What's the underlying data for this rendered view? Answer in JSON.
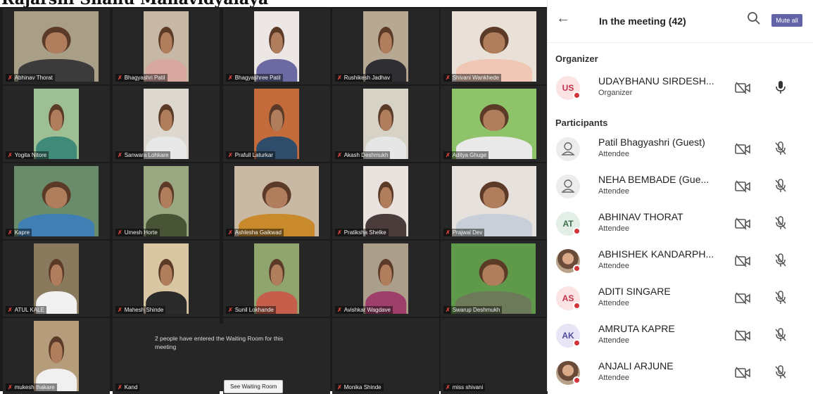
{
  "page_header": "Rajarshi Shahu Mahavidyalaya",
  "meeting_panel": {
    "title": "In the meeting (42)",
    "mute_all_label": "Mute all",
    "organizer_heading": "Organizer",
    "participants_heading": "Participants",
    "organizer": {
      "initials": "US",
      "name": "UDAYBHANU SIRDESH...",
      "role": "Organizer",
      "avatar_color": "#fbe3e3",
      "initials_color": "#c4314b"
    },
    "participants": [
      {
        "initials": "",
        "name": "Patil Bhagyashri  (Guest)",
        "role": "Attendee",
        "type": "guest"
      },
      {
        "initials": "",
        "name": "NEHA BEMBADE  (Gue...",
        "role": "Attendee",
        "type": "guest"
      },
      {
        "initials": "AT",
        "name": "ABHINAV THORAT",
        "role": "Attendee",
        "type": "initials",
        "avatar_color": "#e3efe6",
        "initials_color": "#3b6e4a"
      },
      {
        "initials": "",
        "name": "ABHISHEK KANDARPH...",
        "role": "Attendee",
        "type": "photo"
      },
      {
        "initials": "AS",
        "name": "ADITI SINGARE",
        "role": "Attendee",
        "type": "initials",
        "avatar_color": "#fbe3e3",
        "initials_color": "#c4314b"
      },
      {
        "initials": "AK",
        "name": "AMRUTA KAPRE",
        "role": "Attendee",
        "type": "initials",
        "avatar_color": "#e8e6f6",
        "initials_color": "#4f4b9c"
      },
      {
        "initials": "",
        "name": "ANJALI ARJUNE",
        "role": "Attendee",
        "type": "photo"
      }
    ],
    "accent_color": "#6264a7"
  },
  "video_grid": {
    "tiles": [
      {
        "label": "Abhinav Thorat",
        "bg": "#a99f86",
        "shirt": "#3b3b3b"
      },
      {
        "label": "Bhagyashri Patil",
        "bg": "#c7b8a6",
        "shirt": "#d8a7a0"
      },
      {
        "label": "Bhagyashree Patil",
        "bg": "#ece7e4",
        "shirt": "#6b6aa3"
      },
      {
        "label": "Rushikesh Jadhav",
        "bg": "#b6a893",
        "shirt": "#2e2e33"
      },
      {
        "label": "Shivani Wankhede",
        "bg": "#e9e0d7",
        "shirt": "#f0c6b5"
      },
      {
        "label": "Yogita Nitore",
        "bg": "#9dbf93",
        "shirt": "#3f8a78"
      },
      {
        "label": "Sanwara Lohkare",
        "bg": "#dcd7cf",
        "shirt": "#e8e8e8"
      },
      {
        "label": "Prafull Laturkar",
        "bg": "#c36b3a",
        "shirt": "#2f4d6b"
      },
      {
        "label": "Akash Deshmukh",
        "bg": "#d6d2c5",
        "shirt": "#e6e6e6"
      },
      {
        "label": "Aditya Ghuge",
        "bg": "#8ec36a",
        "shirt": "#e9e9e9"
      },
      {
        "label": "Kapre",
        "bg": "#6a8c6a",
        "shirt": "#3f7fb3"
      },
      {
        "label": "Umesh Horte",
        "bg": "#9aa882",
        "shirt": "#495437"
      },
      {
        "label": "Ashlesha Gaikwad",
        "bg": "#c8b8a4",
        "shirt": "#c88a2a"
      },
      {
        "label": "Pratiksha Shelke",
        "bg": "#e9e2df",
        "shirt": "#4b3c3c"
      },
      {
        "label": "Prajwal Dev",
        "bg": "#e6e1dc",
        "shirt": "#c9cfd8"
      },
      {
        "label": "ATUL KALE",
        "bg": "#8a7a5d",
        "shirt": "#f1f1f1"
      },
      {
        "label": "Mahesh Shinde",
        "bg": "#d9c7a4",
        "shirt": "#2a2a2a"
      },
      {
        "label": "Sunil Lokhande",
        "bg": "#90a46e",
        "shirt": "#c55e4a"
      },
      {
        "label": "Avishkar Wagdave",
        "bg": "#ab9e8a",
        "shirt": "#9d3f6a"
      },
      {
        "label": "Swarup Deshmukh",
        "bg": "#5f9a4a",
        "shirt": "#6d7a5a"
      },
      {
        "label": "mukesh thakare",
        "bg": "#b59d7c",
        "shirt": "#f0f0f0"
      },
      {
        "label": "Kand",
        "bg": "",
        "shirt": ""
      },
      {
        "label": "",
        "bg": "",
        "shirt": ""
      },
      {
        "label": "Monika Shinde",
        "bg": "",
        "shirt": ""
      },
      {
        "label": "miss shivani",
        "bg": "",
        "shirt": ""
      }
    ],
    "waiting_room_message": "2 people have entered the Waiting Room for this meeting",
    "waiting_room_button": "See Waiting Room"
  }
}
